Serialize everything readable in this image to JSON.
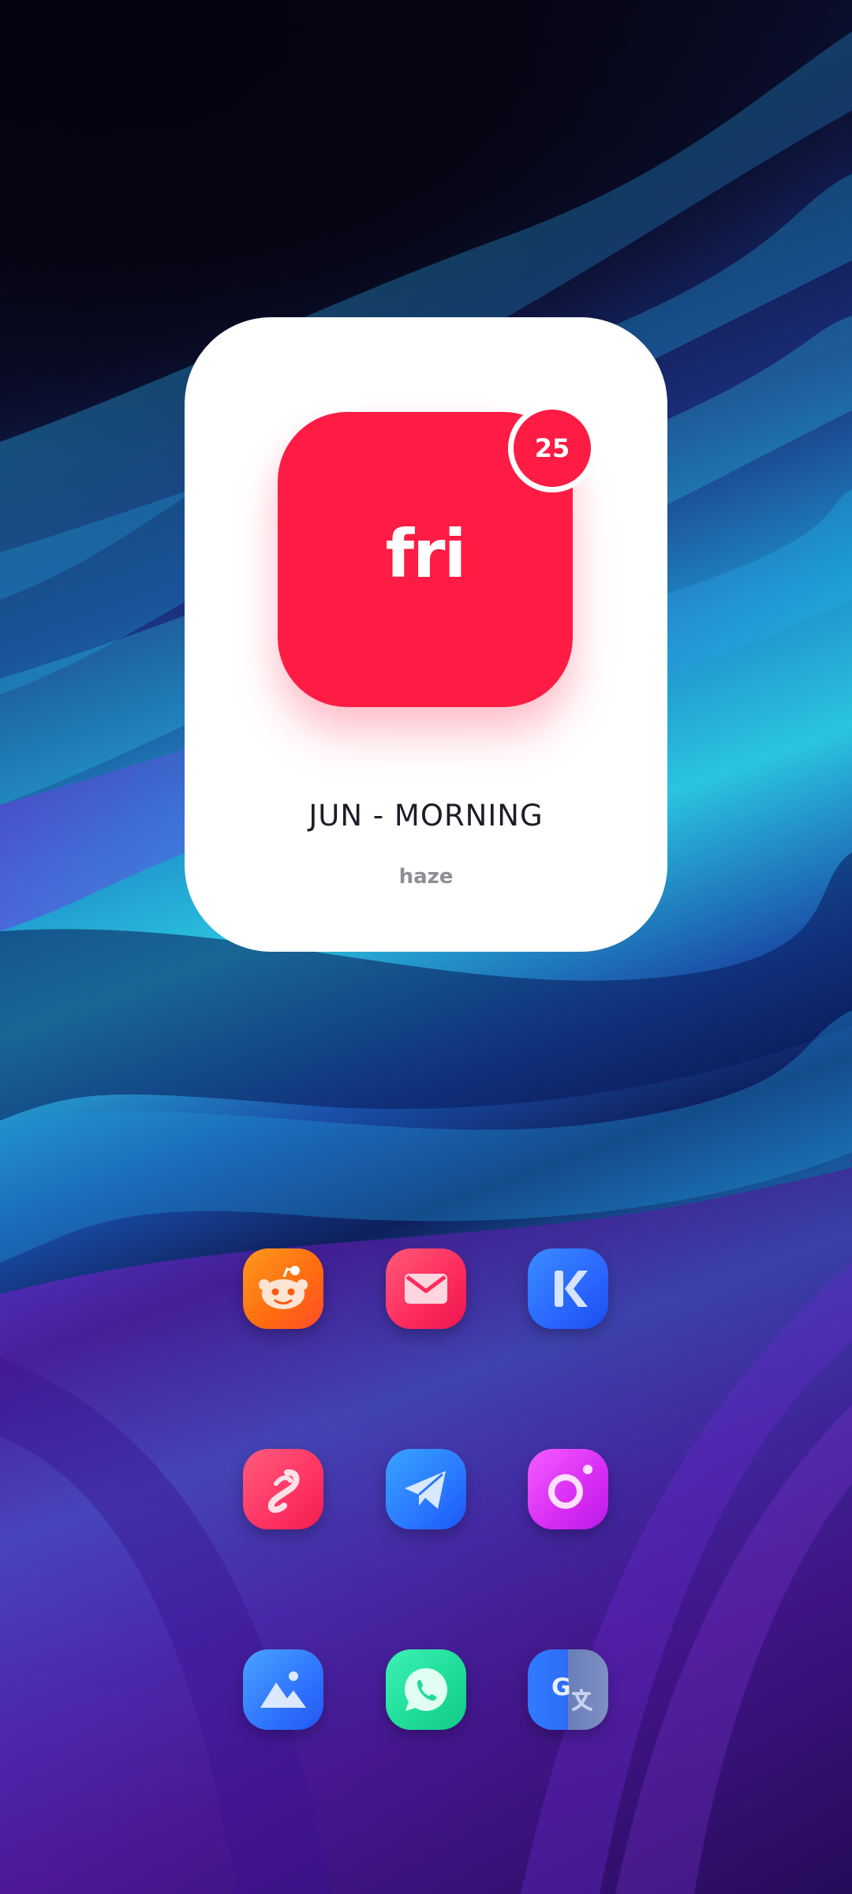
{
  "widget": {
    "day_name": "fri",
    "day_number": "25",
    "month_period": "JUN - MORNING",
    "brand": "haze",
    "accent_color": "#fe1c44"
  },
  "apps": [
    {
      "name": "reddit",
      "icon": "reddit-icon",
      "color": "#ff6a10"
    },
    {
      "name": "gmail",
      "icon": "mail-icon",
      "color": "#ff2a5c"
    },
    {
      "name": "kwgt",
      "icon": "kwgt-icon",
      "color": "#2a66ff"
    },
    {
      "name": "airtel",
      "icon": "airtel-icon",
      "color": "#ff3462"
    },
    {
      "name": "telegram",
      "icon": "telegram-icon",
      "color": "#2a78ff"
    },
    {
      "name": "camera",
      "icon": "camera-icon",
      "color": "#d82cf4"
    },
    {
      "name": "gallery",
      "icon": "gallery-icon",
      "color": "#2f74ff"
    },
    {
      "name": "whatsapp",
      "icon": "whatsapp-icon",
      "color": "#1edc98"
    },
    {
      "name": "google-translate",
      "icon": "translate-icon",
      "color": "#2f6cf6"
    }
  ]
}
